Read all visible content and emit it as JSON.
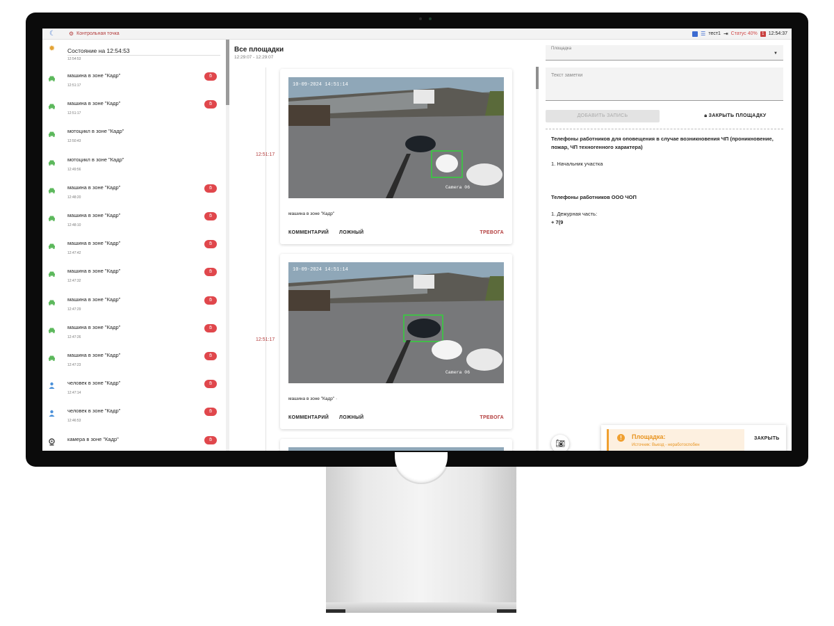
{
  "topbar": {
    "point_label": "Контрольная точка",
    "user": "тест1",
    "status": "Статус 40%",
    "status_count": "1",
    "clock": "12:54:37",
    "colors": {
      "logo": "#4a7ed6",
      "point": "#b23a3a",
      "status": "#d14a4a"
    }
  },
  "left": {
    "state_title": "Состояние на 12:54:53",
    "state_time": "12:54:53",
    "events": [
      {
        "icon": "car-icon",
        "title": "машина в зоне \"Кадр\"",
        "time": "12:51:17",
        "button": true
      },
      {
        "icon": "car-icon",
        "title": "машина в зоне \"Кадр\"",
        "time": "12:51:17",
        "button": true
      },
      {
        "icon": "car-icon",
        "title": "мотоцикл в зоне \"Кадр\"",
        "time": "12:50:43",
        "button": false
      },
      {
        "icon": "car-icon",
        "title": "мотоцикл в зоне \"Кадр\"",
        "time": "12:49:56",
        "button": false
      },
      {
        "icon": "car-icon",
        "title": "машина в зоне \"Кадр\"",
        "time": "12:48:20",
        "button": true
      },
      {
        "icon": "car-icon",
        "title": "машина в зоне \"Кадр\"",
        "time": "12:48:10",
        "button": true
      },
      {
        "icon": "car-icon",
        "title": "машина в зоне \"Кадр\"",
        "time": "12:47:42",
        "button": true
      },
      {
        "icon": "car-icon",
        "title": "машина в зоне \"Кадр\"",
        "time": "12:47:32",
        "button": true
      },
      {
        "icon": "car-icon",
        "title": "машина в зоне \"Кадр\"",
        "time": "12:47:29",
        "button": true
      },
      {
        "icon": "car-icon",
        "title": "машина в зоне \"Кадр\"",
        "time": "12:47:26",
        "button": true
      },
      {
        "icon": "car-icon",
        "title": "машина в зоне \"Кадр\"",
        "time": "12:47:23",
        "button": true
      },
      {
        "icon": "person-icon",
        "title": "человек в зоне \"Кадр\"",
        "time": "12:47:14",
        "button": true
      },
      {
        "icon": "person-icon",
        "title": "человек в зоне \"Кадр\"",
        "time": "12:46:53",
        "button": true
      },
      {
        "icon": "camera-icon",
        "title": "камера в зоне \"Кадр\"",
        "time": "",
        "button": true
      }
    ]
  },
  "middle": {
    "title": "Все площадки",
    "range": "12:29:07 - 12:29:07",
    "cards": [
      {
        "time": "12:51:17",
        "cam_stamp": "10-09-2024 14:51:14",
        "cam_name": "Camera 06",
        "caption": "машина в зоне \"Кадр\"",
        "comment": "КОММЕНТАРИЙ",
        "false": "ЛОЖНЫЙ",
        "alarm": "ТРЕВОГА"
      },
      {
        "time": "12:51:17",
        "cam_stamp": "10-09-2024 14:51:14",
        "cam_name": "Camera 06",
        "caption": "машина в зоне \"Кадр\" ·",
        "comment": "КОММЕНТАРИЙ",
        "false": "ЛОЖНЫЙ",
        "alarm": "ТРЕВОГА"
      }
    ]
  },
  "right": {
    "select_label": "Площадка",
    "note_placeholder": "Текст заметки",
    "add_button": "ДОБАВИТЬ ЗАПИСЬ",
    "close_button": "ЗАКРЫТЬ ПЛОЩАДКУ",
    "phones_title_1": "Телефоны работников для оповещения в случае возникновения ЧП (проникновение, пожар, ЧП техногенного характера)",
    "phones_item_1": "1. Начальник участка",
    "phones_title_2": "Телефоны работников ООО ЧОП",
    "phones_item_2": "1. Дежурная часть:",
    "phones_value_2": "+ 7(9",
    "toast_title": "Площадка:",
    "toast_sub": "Источник: Выезд - неработоспобен",
    "toast_close": "ЗАКРЫТЬ"
  }
}
